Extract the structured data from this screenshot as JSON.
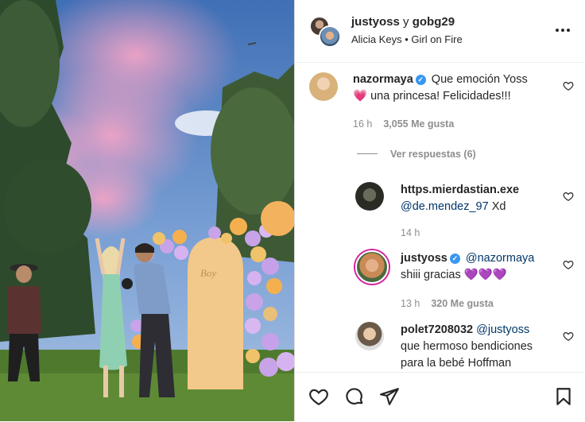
{
  "post": {
    "image_alt": "",
    "sign_text": "Boy"
  },
  "header": {
    "user1": "justyoss",
    "connector": "y",
    "user2": "gobg29",
    "song_artist": "Alicia Keys",
    "song_sep": "•",
    "song_title": "Girl on Fire",
    "more_icon": "more-horizontal-icon"
  },
  "comments": [
    {
      "username": "nazormaya",
      "verified": true,
      "text_line1": "Que emoción Yoss",
      "emoji": "💗",
      "text_line2": "una princesa! Felicidades!!!",
      "time": "16 h",
      "likes": "3,055 Me gusta"
    },
    {
      "view_replies": "Ver respuestas (6)"
    },
    {
      "username": "https.mierdastian.exe",
      "mention": "@de.mendez_97",
      "text": "Xd",
      "time": "14 h"
    },
    {
      "username": "justyoss",
      "verified": true,
      "mention": "@nazormaya",
      "text": "shiii gracias",
      "emoji": "💜💜💜",
      "time": "13 h",
      "likes": "320 Me gusta"
    },
    {
      "username": "polet7208032",
      "mention": "@justyoss",
      "text_line1": "que hermoso bendiciones",
      "text_line2": "para la bebé Hoffman"
    }
  ],
  "colors": {
    "verified": "#3897f0",
    "mention": "#00376b",
    "meta": "#8e8e8e"
  },
  "actions": [
    "heart-icon",
    "comment-icon",
    "share-icon",
    "bookmark-icon"
  ]
}
